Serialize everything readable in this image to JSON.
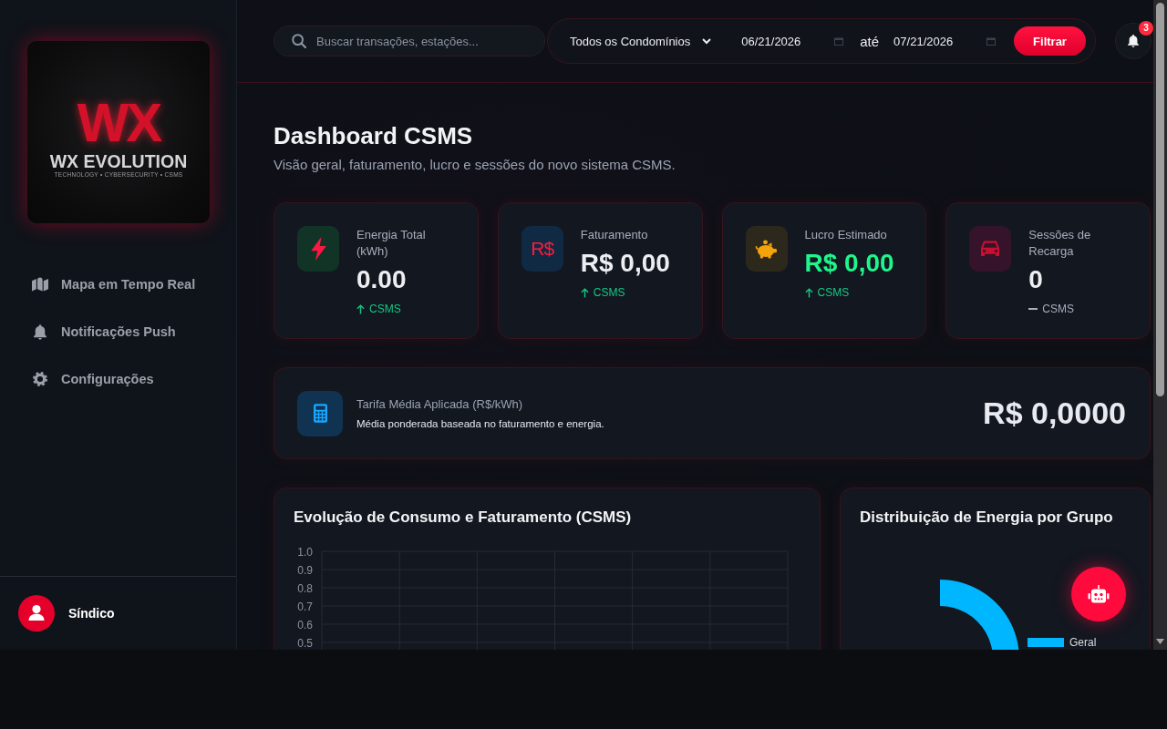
{
  "sidebar": {
    "logo": {
      "monogram": "WX",
      "name": "WX EVOLUTION",
      "tagline": "TECHNOLOGY • CYBERSECURITY • CSMS"
    },
    "nav": [
      {
        "kind": "map",
        "label": "Mapa em Tempo Real",
        "selected": false
      },
      {
        "kind": "notifications",
        "label": "Notificações Push",
        "selected": false
      },
      {
        "kind": "settings",
        "label": "Configurações",
        "selected": false
      }
    ],
    "user": {
      "name": "Síndico"
    }
  },
  "header": {
    "search": {
      "placeholder": "Buscar transações, estações..."
    },
    "filter": {
      "condominium": "Todos os Condomínios",
      "start_date": "06/21/2026",
      "separator": "até",
      "end_date": "07/21/2026",
      "button": "Filtrar"
    },
    "notifications": {
      "count": "3"
    }
  },
  "page": {
    "title": "Dashboard CSMS",
    "subtitle": "Visão geral, faturamento, lucro e sessões do novo sistema CSMS."
  },
  "stats": [
    {
      "kind": "energy",
      "label": "Energia Total (kWh)",
      "value": "0.00",
      "rising": true,
      "trend_label": "CSMS"
    },
    {
      "kind": "revenue",
      "icon_text": "R$",
      "label": "Faturamento",
      "value": "R$ 0,00",
      "rising": true,
      "trend_label": "CSMS"
    },
    {
      "kind": "profit",
      "label": "Lucro Estimado",
      "value": "R$ 0,00",
      "rising": true,
      "trend_label": "CSMS"
    },
    {
      "kind": "sessions",
      "label": "Sessões de Recarga",
      "value": "0",
      "rising": false,
      "trend_label": "CSMS"
    }
  ],
  "tariff": {
    "label": "Tarifa Média Aplicada (R$/kWh)",
    "description": "Média ponderada baseada no faturamento e energia.",
    "value": "R$ 0,0000"
  },
  "charts": {
    "consumption": {
      "title": "Evolução de Consumo e Faturamento (CSMS)",
      "chart_data": {
        "type": "line",
        "categories": [
          null,
          null,
          null,
          null,
          null,
          null,
          null
        ],
        "ylim": [
          0,
          1
        ],
        "yticks": [
          {
            "value": 1,
            "label": "1.0"
          },
          {
            "value": 0.9,
            "label": "0.9"
          },
          {
            "value": 0.8,
            "label": "0.8"
          },
          {
            "value": 0.7,
            "label": "0.7"
          },
          {
            "value": 0.6,
            "label": "0.6"
          },
          {
            "value": 0.5,
            "label": "0.5"
          }
        ],
        "grid": true
      }
    },
    "distribution": {
      "title": "Distribuição de Energia por Grupo",
      "legend": [
        {
          "label": "Geral",
          "color": "#00b6ff"
        }
      ]
    }
  }
}
